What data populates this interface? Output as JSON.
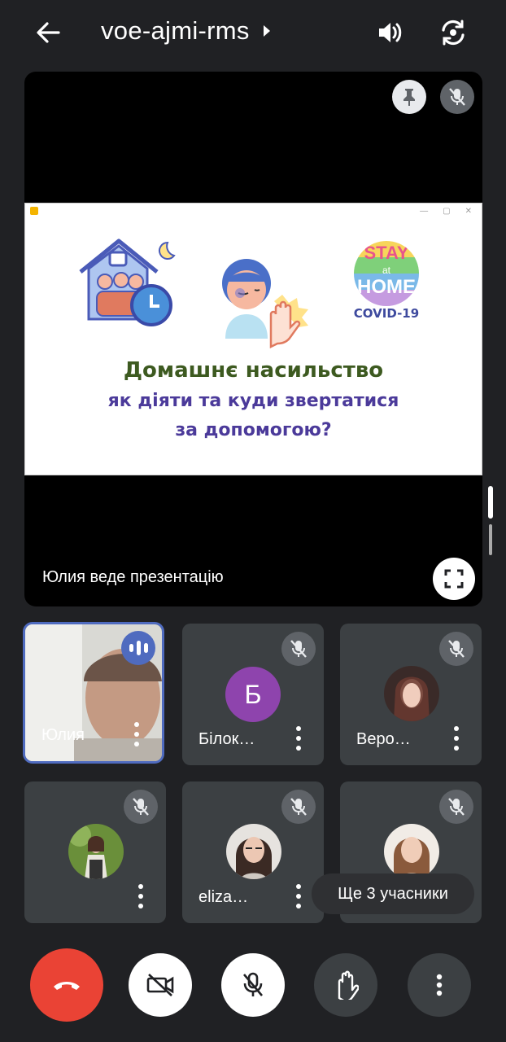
{
  "header": {
    "meeting_code": "voe-ajmi-rms"
  },
  "stage": {
    "slide": {
      "line1": "Домашнє насильство",
      "line2": "як діяти та куди звертатися",
      "line3": "за допомогою?",
      "logo_stay": "STAY",
      "logo_at": "at",
      "logo_home": "HOME",
      "logo_covid": "COVID-19"
    },
    "presenting_label": "Юлия веде презентацію"
  },
  "participants": [
    {
      "name": "Юлия",
      "speaking": true
    },
    {
      "name": "Білок…",
      "initial": "Б",
      "muted": true
    },
    {
      "name": "Веро…",
      "muted": true
    },
    {
      "name": "",
      "muted": true
    },
    {
      "name": "eliza…",
      "muted": true
    },
    {
      "name": "",
      "muted": true
    }
  ],
  "more_participants_label": "Ще 3 учасники",
  "colors": {
    "background": "#202124",
    "end_call": "#ea4335",
    "active_border": "#4f6bbf",
    "avatar_b": "#8e44ad"
  },
  "icons": [
    "back-arrow-icon",
    "caret-right-icon",
    "speaker-icon",
    "switch-camera-icon",
    "pin-icon",
    "mic-off-icon",
    "fullscreen-icon",
    "more-vert-icon",
    "end-call-icon",
    "camera-off-icon",
    "raise-hand-icon",
    "audio-bars-icon"
  ]
}
